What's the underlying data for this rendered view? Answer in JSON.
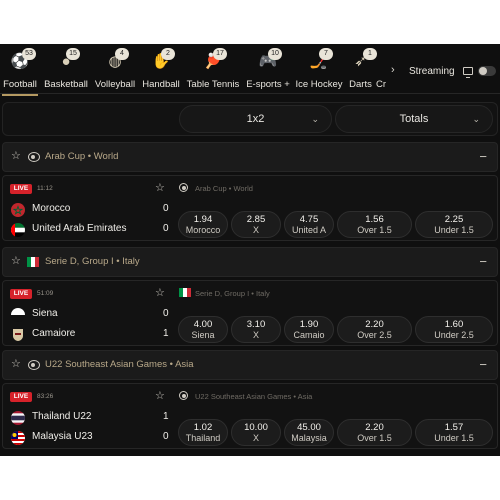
{
  "sports_nav": {
    "items": [
      {
        "label": "Football",
        "count": "53",
        "icon": "football-icon",
        "glyph": "⚽"
      },
      {
        "label": "Basketball",
        "count": "15",
        "icon": "basketball-icon",
        "glyph": "●"
      },
      {
        "label": "Volleyball",
        "count": "4",
        "icon": "volleyball-icon",
        "glyph": "◍"
      },
      {
        "label": "Handball",
        "count": "2",
        "icon": "handball-icon",
        "glyph": "✋"
      },
      {
        "label": "Table Tennis",
        "count": "17",
        "icon": "table-tennis-icon",
        "glyph": "🏓"
      },
      {
        "label": "E-sports +",
        "count": "10",
        "icon": "esports-icon",
        "glyph": "🎮"
      },
      {
        "label": "Ice Hockey",
        "count": "7",
        "icon": "ice-hockey-icon",
        "glyph": "🏒"
      },
      {
        "label": "Darts",
        "count": "1",
        "icon": "darts-icon",
        "glyph": "➶"
      },
      {
        "label": "Cr",
        "count": "",
        "icon": "cricket-icon",
        "glyph": ""
      }
    ],
    "next_glyph": "›",
    "streaming_label": "Streaming"
  },
  "filters": {
    "market_1": "1x2",
    "market_2": "Totals",
    "arrow": "⌄"
  },
  "leagues": [
    {
      "name": "Arab Cup • World",
      "match": {
        "live": "LIVE",
        "clock": "11:12",
        "league": "Arab Cup • World",
        "home": {
          "name": "Morocco",
          "score": "0"
        },
        "away": {
          "name": "United Arab Emirates",
          "score": "0"
        },
        "odds": [
          {
            "value": "1.94",
            "label": "Morocco"
          },
          {
            "value": "2.85",
            "label": "X"
          },
          {
            "value": "4.75",
            "label": "United A"
          },
          {
            "value": "1.56",
            "label": "Over 1.5"
          },
          {
            "value": "2.25",
            "label": "Under 1.5"
          }
        ]
      }
    },
    {
      "name": "Serie D, Group I • Italy",
      "match": {
        "live": "LIVE",
        "clock": "51:09",
        "league": "Serie D, Group I • Italy",
        "home": {
          "name": "Siena",
          "score": "0"
        },
        "away": {
          "name": "Camaiore",
          "score": "1"
        },
        "odds": [
          {
            "value": "4.00",
            "label": "Siena"
          },
          {
            "value": "3.10",
            "label": "X"
          },
          {
            "value": "1.90",
            "label": "Camaio"
          },
          {
            "value": "2.20",
            "label": "Over 2.5"
          },
          {
            "value": "1.60",
            "label": "Under 2.5"
          }
        ]
      }
    },
    {
      "name": "U22 Southeast Asian Games • Asia",
      "match": {
        "live": "LIVE",
        "clock": "83:26",
        "league": "U22 Southeast Asian Games • Asia",
        "home": {
          "name": "Thailand U22",
          "score": "1"
        },
        "away": {
          "name": "Malaysia U23",
          "score": "0"
        },
        "odds": [
          {
            "value": "1.02",
            "label": "Thailand"
          },
          {
            "value": "10.00",
            "label": "X"
          },
          {
            "value": "45.00",
            "label": "Malaysia"
          },
          {
            "value": "2.20",
            "label": "Over 1.5"
          },
          {
            "value": "1.57",
            "label": "Under 1.5"
          }
        ]
      }
    }
  ],
  "glyphs": {
    "star": "☆",
    "collapse": "−"
  },
  "colors": {
    "accent": "#b59a62",
    "live": "#d6222a",
    "league_text": "#b9a98a"
  }
}
